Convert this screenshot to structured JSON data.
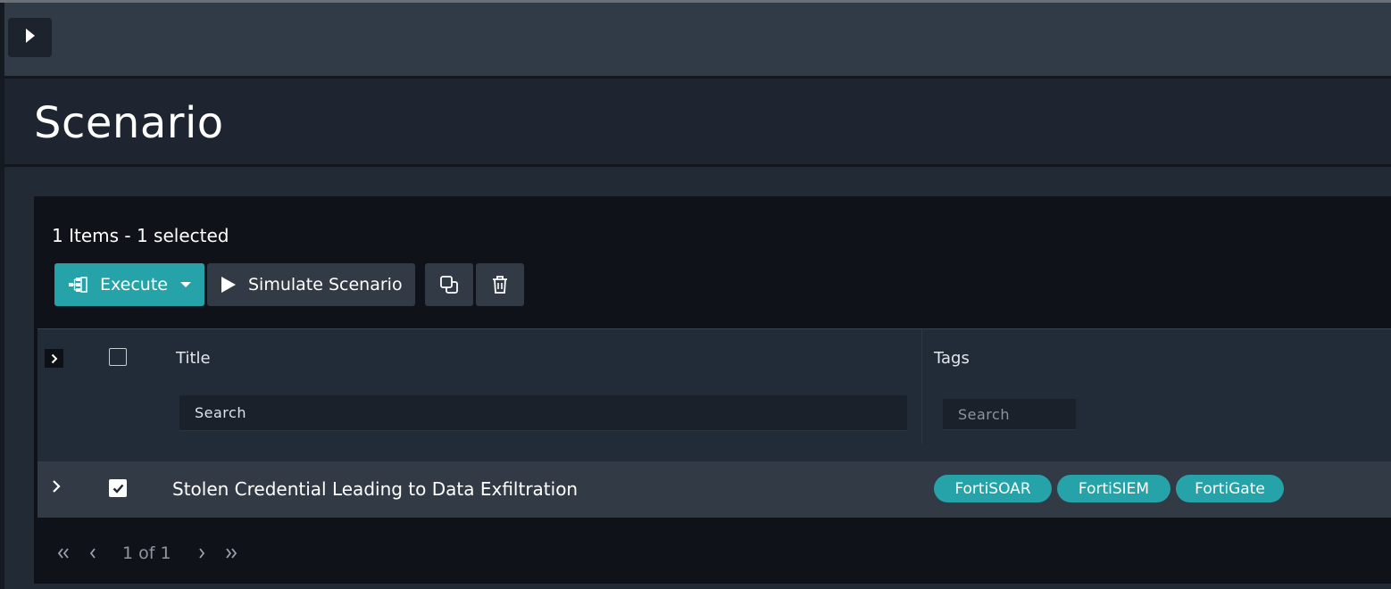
{
  "page": {
    "title": "Scenario"
  },
  "list": {
    "count_text": "1 Items - 1 selected",
    "toolbar": {
      "execute_label": "Execute",
      "simulate_label": "Simulate Scenario"
    },
    "columns": {
      "title": "Title",
      "tags": "Tags"
    },
    "filters": {
      "title_placeholder": "Search",
      "tags_placeholder": "Search"
    },
    "rows": [
      {
        "title": "Stolen Credential Leading to Data Exfiltration",
        "selected": true,
        "tags": [
          "FortiSOAR",
          "FortiSIEM",
          "FortiGate"
        ]
      }
    ],
    "pagination": {
      "info": "1 of 1"
    }
  },
  "colors": {
    "accent": "#25a3a8",
    "topbar": "#313a47",
    "panel": "#0f1319"
  },
  "icons": {
    "sidebar_toggle": "play-right-icon",
    "execute": "workflow-icon",
    "execute_dropdown": "caret-down-icon",
    "simulate": "play-icon",
    "clone": "clone-icon",
    "delete": "trash-icon"
  }
}
